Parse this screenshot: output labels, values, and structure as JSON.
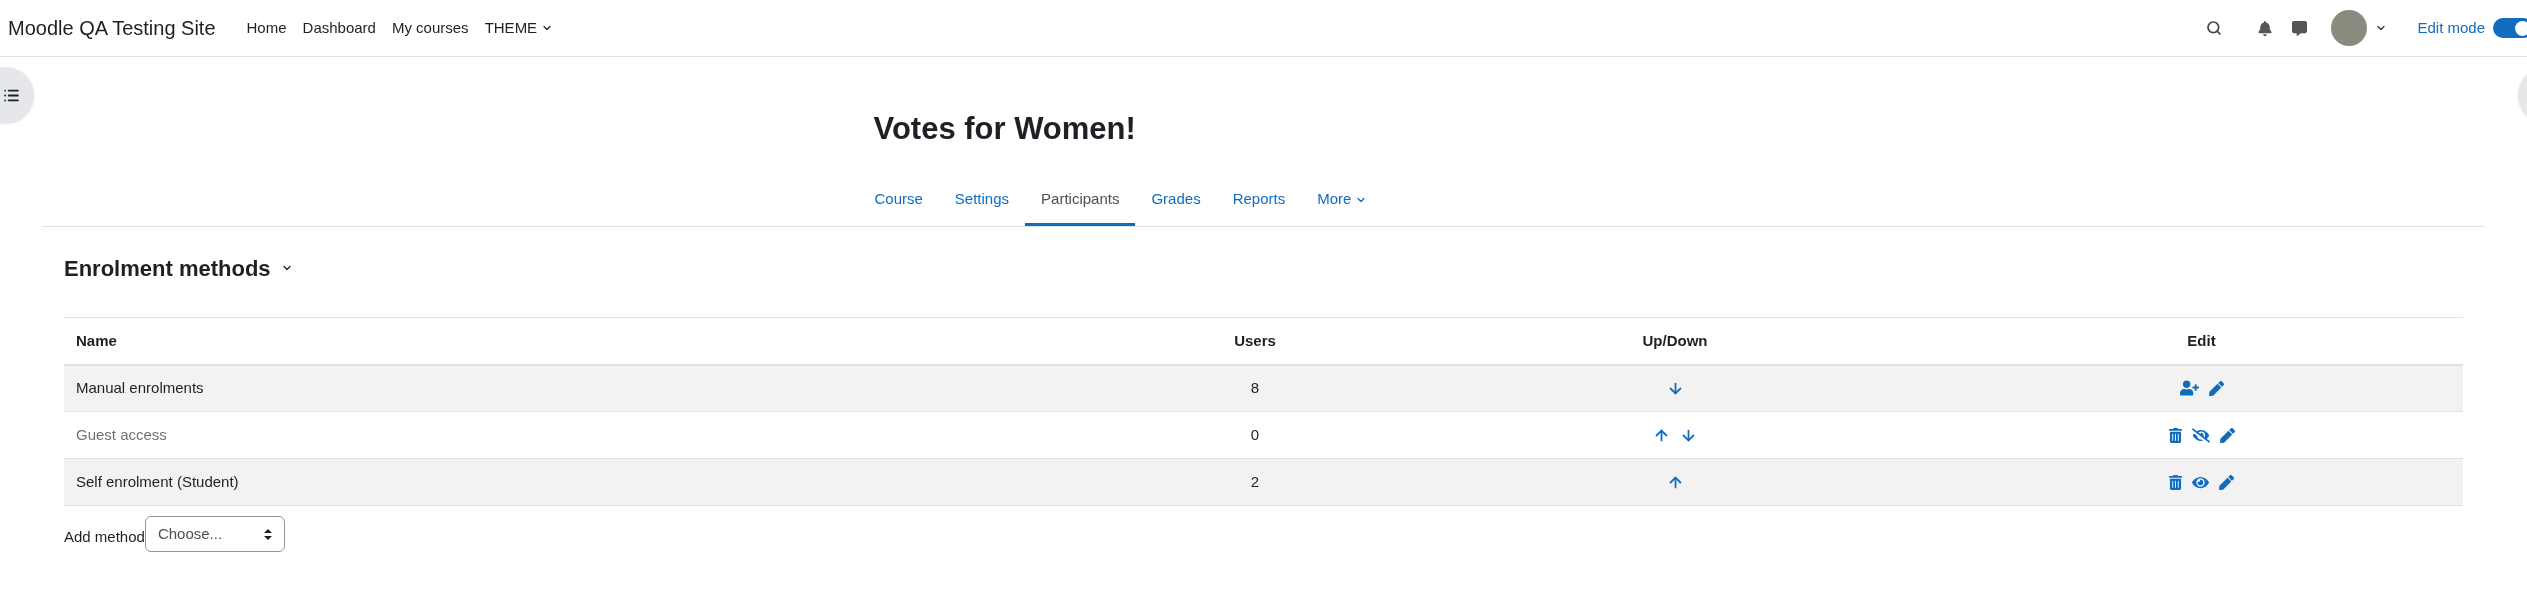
{
  "navbar": {
    "site_name": "Moodle QA Testing Site",
    "links": [
      {
        "label": "Home",
        "dropdown": false
      },
      {
        "label": "Dashboard",
        "dropdown": false
      },
      {
        "label": "My courses",
        "dropdown": false
      },
      {
        "label": "THEME",
        "dropdown": true
      }
    ],
    "edit_mode": {
      "label": "Edit mode",
      "on": true
    }
  },
  "course": {
    "title": "Votes for Women!",
    "tabs": [
      {
        "label": "Course",
        "selected": false,
        "dropdown": false
      },
      {
        "label": "Settings",
        "selected": false,
        "dropdown": false
      },
      {
        "label": "Participants",
        "selected": true,
        "dropdown": false
      },
      {
        "label": "Grades",
        "selected": false,
        "dropdown": false
      },
      {
        "label": "Reports",
        "selected": false,
        "dropdown": false
      },
      {
        "label": "More",
        "selected": false,
        "dropdown": true
      }
    ]
  },
  "section": {
    "heading": "Enrolment methods"
  },
  "table": {
    "columns": [
      "Name",
      "Users",
      "Up/Down",
      "Edit"
    ],
    "rows": [
      {
        "name": "Manual enrolments",
        "users": "8",
        "disabled": false,
        "moves": [
          {
            "kind": "down"
          }
        ],
        "actions": [
          {
            "kind": "enrol"
          },
          {
            "kind": "edit"
          }
        ]
      },
      {
        "name": "Guest access",
        "users": "0",
        "disabled": true,
        "moves": [
          {
            "kind": "up"
          },
          {
            "kind": "down"
          }
        ],
        "actions": [
          {
            "kind": "delete"
          },
          {
            "kind": "show"
          },
          {
            "kind": "edit"
          }
        ]
      },
      {
        "name": "Self enrolment (Student)",
        "users": "2",
        "disabled": false,
        "moves": [
          {
            "kind": "up"
          }
        ],
        "actions": [
          {
            "kind": "delete"
          },
          {
            "kind": "hide"
          },
          {
            "kind": "edit"
          }
        ]
      }
    ]
  },
  "add_method": {
    "label": "Add method",
    "placeholder": "Choose..."
  }
}
